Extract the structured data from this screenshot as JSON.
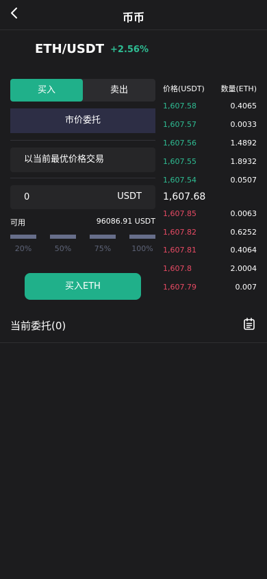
{
  "header": {
    "title": "币币"
  },
  "market": {
    "pair": "ETH/USDT",
    "change": "+2.56%"
  },
  "trade": {
    "tabs": {
      "buy": "买入",
      "sell": "卖出"
    },
    "order_type": "市价委托",
    "best_price_label": "以当前最优价格交易",
    "amount_value": "0",
    "amount_unit": "USDT",
    "available_label": "可用",
    "available_value": "96086.91 USDT",
    "percents": [
      "20%",
      "50%",
      "75%",
      "100%"
    ],
    "buy_button": "买入ETH"
  },
  "orderbook": {
    "price_header": "价格(USDT)",
    "qty_header": "数量(ETH)",
    "bids": [
      {
        "price": "1,607.58",
        "qty": "0.4065"
      },
      {
        "price": "1,607.57",
        "qty": "0.0033"
      },
      {
        "price": "1,607.56",
        "qty": "1.4892"
      },
      {
        "price": "1,607.55",
        "qty": "1.8932"
      },
      {
        "price": "1,607.54",
        "qty": "0.0507"
      }
    ],
    "last_price": "1,607.68",
    "asks": [
      {
        "price": "1,607.85",
        "qty": "0.0063"
      },
      {
        "price": "1,607.82",
        "qty": "0.6252"
      },
      {
        "price": "1,607.81",
        "qty": "0.4064"
      },
      {
        "price": "1,607.8",
        "qty": "2.0004"
      },
      {
        "price": "1,607.79",
        "qty": "0.007"
      }
    ]
  },
  "orders": {
    "title": "当前委托(0)"
  },
  "colors": {
    "buy_accent": "#20b08a",
    "bid_text": "#2ebd93",
    "ask_text": "#e84a64",
    "background": "#1c1c1e"
  },
  "icons": {
    "back": "chevron-left-icon",
    "orders": "document-list-icon"
  }
}
